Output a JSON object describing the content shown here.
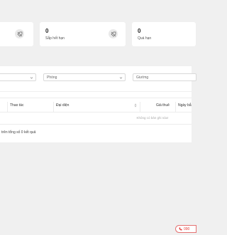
{
  "stats": [
    {
      "value": "0",
      "label": "Sắp hết hạn",
      "icon": "tag-off-icon"
    },
    {
      "value": "0",
      "label": "Quá hạn"
    }
  ],
  "filters": {
    "room_placeholder": "Phòng",
    "bed_placeholder": "Giường"
  },
  "table": {
    "columns": [
      "Thao tác",
      "Đại diện",
      "Giá thuê",
      "Ngày bắ"
    ],
    "empty_text": "Không có bản ghi nào!",
    "summary": "trên tổng số 0 kết quả"
  },
  "contact": {
    "phone_label": "090"
  },
  "colors": {
    "page_bg": "#f0f0f0",
    "accent_red": "#e53935"
  }
}
